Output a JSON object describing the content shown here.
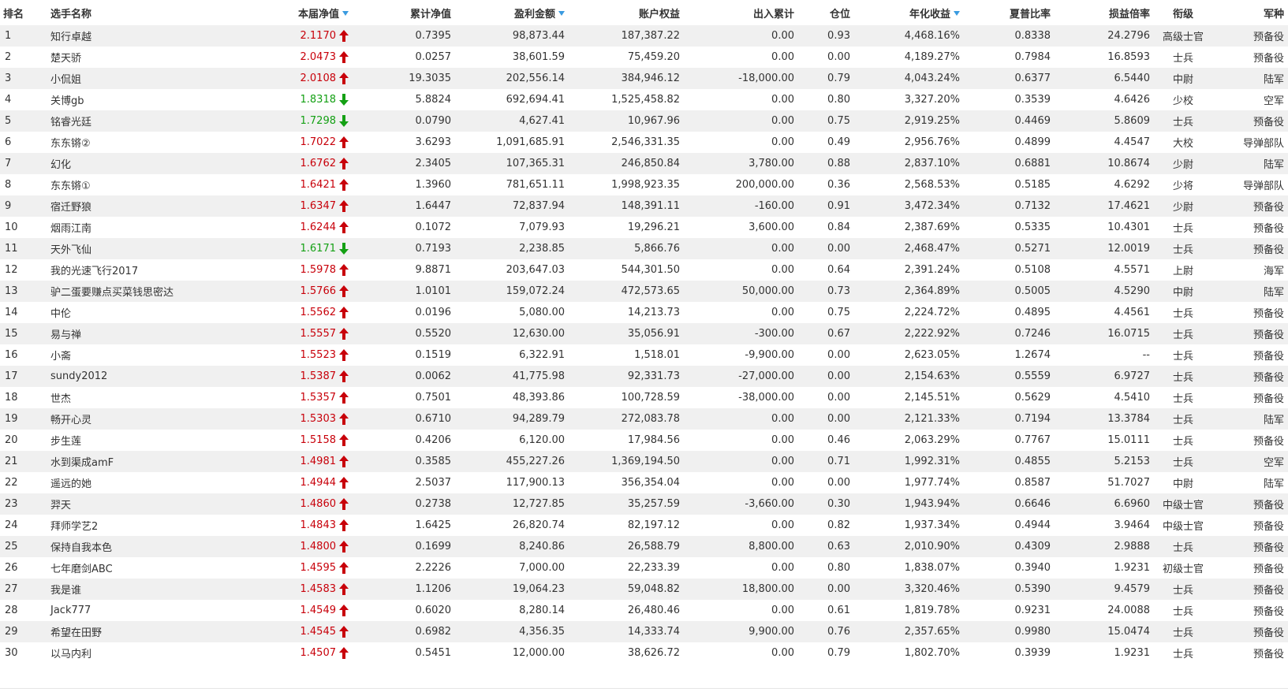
{
  "headers": {
    "rank": "排名",
    "name": "选手名称",
    "nav": "本届净值",
    "cum_nav": "累计净值",
    "profit": "盈利金额",
    "equity": "账户权益",
    "flow": "出入累计",
    "position": "仓位",
    "annual": "年化收益",
    "sharpe": "夏普比率",
    "ratio": "损益倍率",
    "rank_title": "衔级",
    "branch": "军种"
  },
  "colors": {
    "up": "#c8000a",
    "down": "#14a014",
    "sort": "#3a9be0",
    "alt_row": "#f0f0f0"
  },
  "rows": [
    {
      "rank": "1",
      "name": "知行卓越",
      "nav": "2.1170",
      "dir": "up",
      "cum": "0.7395",
      "profit": "98,873.44",
      "equity": "187,387.22",
      "flow": "0.00",
      "pos": "0.93",
      "annual": "4,468.16%",
      "sharpe": "0.8338",
      "ratio": "24.2796",
      "rank_title": "高级士官",
      "branch": "预备役"
    },
    {
      "rank": "2",
      "name": "楚天骄",
      "nav": "2.0473",
      "dir": "up",
      "cum": "0.0257",
      "profit": "38,601.59",
      "equity": "75,459.20",
      "flow": "0.00",
      "pos": "0.00",
      "annual": "4,189.27%",
      "sharpe": "0.7984",
      "ratio": "16.8593",
      "rank_title": "士兵",
      "branch": "预备役"
    },
    {
      "rank": "3",
      "name": "小侃姐",
      "nav": "2.0108",
      "dir": "up",
      "cum": "19.3035",
      "profit": "202,556.14",
      "equity": "384,946.12",
      "flow": "-18,000.00",
      "pos": "0.79",
      "annual": "4,043.24%",
      "sharpe": "0.6377",
      "ratio": "6.5440",
      "rank_title": "中尉",
      "branch": "陆军"
    },
    {
      "rank": "4",
      "name": "关博gb",
      "nav": "1.8318",
      "dir": "down",
      "cum": "5.8824",
      "profit": "692,694.41",
      "equity": "1,525,458.82",
      "flow": "0.00",
      "pos": "0.80",
      "annual": "3,327.20%",
      "sharpe": "0.3539",
      "ratio": "4.6426",
      "rank_title": "少校",
      "branch": "空军"
    },
    {
      "rank": "5",
      "name": "铭睿光廷",
      "nav": "1.7298",
      "dir": "down",
      "cum": "0.0790",
      "profit": "4,627.41",
      "equity": "10,967.96",
      "flow": "0.00",
      "pos": "0.75",
      "annual": "2,919.25%",
      "sharpe": "0.4469",
      "ratio": "5.8609",
      "rank_title": "士兵",
      "branch": "预备役"
    },
    {
      "rank": "6",
      "name": "东东锵②",
      "nav": "1.7022",
      "dir": "up",
      "cum": "3.6293",
      "profit": "1,091,685.91",
      "equity": "2,546,331.35",
      "flow": "0.00",
      "pos": "0.49",
      "annual": "2,956.76%",
      "sharpe": "0.4899",
      "ratio": "4.4547",
      "rank_title": "大校",
      "branch": "导弹部队"
    },
    {
      "rank": "7",
      "name": "幻化",
      "nav": "1.6762",
      "dir": "up",
      "cum": "2.3405",
      "profit": "107,365.31",
      "equity": "246,850.84",
      "flow": "3,780.00",
      "pos": "0.88",
      "annual": "2,837.10%",
      "sharpe": "0.6881",
      "ratio": "10.8674",
      "rank_title": "少尉",
      "branch": "陆军"
    },
    {
      "rank": "8",
      "name": "东东锵①",
      "nav": "1.6421",
      "dir": "up",
      "cum": "1.3960",
      "profit": "781,651.11",
      "equity": "1,998,923.35",
      "flow": "200,000.00",
      "pos": "0.36",
      "annual": "2,568.53%",
      "sharpe": "0.5185",
      "ratio": "4.6292",
      "rank_title": "少将",
      "branch": "导弹部队"
    },
    {
      "rank": "9",
      "name": "宿迁野狼",
      "nav": "1.6347",
      "dir": "up",
      "cum": "1.6447",
      "profit": "72,837.94",
      "equity": "148,391.11",
      "flow": "-160.00",
      "pos": "0.91",
      "annual": "3,472.34%",
      "sharpe": "0.7132",
      "ratio": "17.4621",
      "rank_title": "少尉",
      "branch": "预备役"
    },
    {
      "rank": "10",
      "name": "烟雨江南",
      "nav": "1.6244",
      "dir": "up",
      "cum": "0.1072",
      "profit": "7,079.93",
      "equity": "19,296.21",
      "flow": "3,600.00",
      "pos": "0.84",
      "annual": "2,387.69%",
      "sharpe": "0.5335",
      "ratio": "10.4301",
      "rank_title": "士兵",
      "branch": "预备役"
    },
    {
      "rank": "11",
      "name": "天外飞仙",
      "nav": "1.6171",
      "dir": "down",
      "cum": "0.7193",
      "profit": "2,238.85",
      "equity": "5,866.76",
      "flow": "0.00",
      "pos": "0.00",
      "annual": "2,468.47%",
      "sharpe": "0.5271",
      "ratio": "12.0019",
      "rank_title": "士兵",
      "branch": "预备役"
    },
    {
      "rank": "12",
      "name": "我的光速飞行2017",
      "nav": "1.5978",
      "dir": "up",
      "cum": "9.8871",
      "profit": "203,647.03",
      "equity": "544,301.50",
      "flow": "0.00",
      "pos": "0.64",
      "annual": "2,391.24%",
      "sharpe": "0.5108",
      "ratio": "4.5571",
      "rank_title": "上尉",
      "branch": "海军"
    },
    {
      "rank": "13",
      "name": "驴二蛋要赚点买菜钱思密达",
      "nav": "1.5766",
      "dir": "up",
      "cum": "1.0101",
      "profit": "159,072.24",
      "equity": "472,573.65",
      "flow": "50,000.00",
      "pos": "0.73",
      "annual": "2,364.89%",
      "sharpe": "0.5005",
      "ratio": "4.5290",
      "rank_title": "中尉",
      "branch": "陆军"
    },
    {
      "rank": "14",
      "name": "中伦",
      "nav": "1.5562",
      "dir": "up",
      "cum": "0.0196",
      "profit": "5,080.00",
      "equity": "14,213.73",
      "flow": "0.00",
      "pos": "0.75",
      "annual": "2,224.72%",
      "sharpe": "0.4895",
      "ratio": "4.4561",
      "rank_title": "士兵",
      "branch": "预备役"
    },
    {
      "rank": "15",
      "name": "易与禅",
      "nav": "1.5557",
      "dir": "up",
      "cum": "0.5520",
      "profit": "12,630.00",
      "equity": "35,056.91",
      "flow": "-300.00",
      "pos": "0.67",
      "annual": "2,222.92%",
      "sharpe": "0.7246",
      "ratio": "16.0715",
      "rank_title": "士兵",
      "branch": "预备役"
    },
    {
      "rank": "16",
      "name": "小斋",
      "nav": "1.5523",
      "dir": "up",
      "cum": "0.1519",
      "profit": "6,322.91",
      "equity": "1,518.01",
      "flow": "-9,900.00",
      "pos": "0.00",
      "annual": "2,623.05%",
      "sharpe": "1.2674",
      "ratio": "--",
      "rank_title": "士兵",
      "branch": "预备役"
    },
    {
      "rank": "17",
      "name": "sundy2012",
      "nav": "1.5387",
      "dir": "up",
      "cum": "0.0062",
      "profit": "41,775.98",
      "equity": "92,331.73",
      "flow": "-27,000.00",
      "pos": "0.00",
      "annual": "2,154.63%",
      "sharpe": "0.5559",
      "ratio": "6.9727",
      "rank_title": "士兵",
      "branch": "预备役"
    },
    {
      "rank": "18",
      "name": "世杰",
      "nav": "1.5357",
      "dir": "up",
      "cum": "0.7501",
      "profit": "48,393.86",
      "equity": "100,728.59",
      "flow": "-38,000.00",
      "pos": "0.00",
      "annual": "2,145.51%",
      "sharpe": "0.5629",
      "ratio": "4.5410",
      "rank_title": "士兵",
      "branch": "预备役"
    },
    {
      "rank": "19",
      "name": "畅开心灵",
      "nav": "1.5303",
      "dir": "up",
      "cum": "0.6710",
      "profit": "94,289.79",
      "equity": "272,083.78",
      "flow": "0.00",
      "pos": "0.00",
      "annual": "2,121.33%",
      "sharpe": "0.7194",
      "ratio": "13.3784",
      "rank_title": "士兵",
      "branch": "陆军"
    },
    {
      "rank": "20",
      "name": "步生莲",
      "nav": "1.5158",
      "dir": "up",
      "cum": "0.4206",
      "profit": "6,120.00",
      "equity": "17,984.56",
      "flow": "0.00",
      "pos": "0.46",
      "annual": "2,063.29%",
      "sharpe": "0.7767",
      "ratio": "15.0111",
      "rank_title": "士兵",
      "branch": "预备役"
    },
    {
      "rank": "21",
      "name": "水到渠成amF",
      "nav": "1.4981",
      "dir": "up",
      "cum": "0.3585",
      "profit": "455,227.26",
      "equity": "1,369,194.50",
      "flow": "0.00",
      "pos": "0.71",
      "annual": "1,992.31%",
      "sharpe": "0.4855",
      "ratio": "5.2153",
      "rank_title": "士兵",
      "branch": "空军"
    },
    {
      "rank": "22",
      "name": "遥远的她",
      "nav": "1.4944",
      "dir": "up",
      "cum": "2.5037",
      "profit": "117,900.13",
      "equity": "356,354.04",
      "flow": "0.00",
      "pos": "0.00",
      "annual": "1,977.74%",
      "sharpe": "0.8587",
      "ratio": "51.7027",
      "rank_title": "中尉",
      "branch": "陆军"
    },
    {
      "rank": "23",
      "name": "羿天",
      "nav": "1.4860",
      "dir": "up",
      "cum": "0.2738",
      "profit": "12,727.85",
      "equity": "35,257.59",
      "flow": "-3,660.00",
      "pos": "0.30",
      "annual": "1,943.94%",
      "sharpe": "0.6646",
      "ratio": "6.6960",
      "rank_title": "中级士官",
      "branch": "预备役"
    },
    {
      "rank": "24",
      "name": "拜师学艺2",
      "nav": "1.4843",
      "dir": "up",
      "cum": "1.6425",
      "profit": "26,820.74",
      "equity": "82,197.12",
      "flow": "0.00",
      "pos": "0.82",
      "annual": "1,937.34%",
      "sharpe": "0.4944",
      "ratio": "3.9464",
      "rank_title": "中级士官",
      "branch": "预备役"
    },
    {
      "rank": "25",
      "name": "保持自我本色",
      "nav": "1.4800",
      "dir": "up",
      "cum": "0.1699",
      "profit": "8,240.86",
      "equity": "26,588.79",
      "flow": "8,800.00",
      "pos": "0.63",
      "annual": "2,010.90%",
      "sharpe": "0.4309",
      "ratio": "2.9888",
      "rank_title": "士兵",
      "branch": "预备役"
    },
    {
      "rank": "26",
      "name": "七年磨剑ABC",
      "nav": "1.4595",
      "dir": "up",
      "cum": "2.2226",
      "profit": "7,000.00",
      "equity": "22,233.39",
      "flow": "0.00",
      "pos": "0.80",
      "annual": "1,838.07%",
      "sharpe": "0.3940",
      "ratio": "1.9231",
      "rank_title": "初级士官",
      "branch": "预备役"
    },
    {
      "rank": "27",
      "name": "我是谁",
      "nav": "1.4583",
      "dir": "up",
      "cum": "1.1206",
      "profit": "19,064.23",
      "equity": "59,048.82",
      "flow": "18,800.00",
      "pos": "0.00",
      "annual": "3,320.46%",
      "sharpe": "0.5390",
      "ratio": "9.4579",
      "rank_title": "士兵",
      "branch": "预备役"
    },
    {
      "rank": "28",
      "name": "Jack777",
      "nav": "1.4549",
      "dir": "up",
      "cum": "0.6020",
      "profit": "8,280.14",
      "equity": "26,480.46",
      "flow": "0.00",
      "pos": "0.61",
      "annual": "1,819.78%",
      "sharpe": "0.9231",
      "ratio": "24.0088",
      "rank_title": "士兵",
      "branch": "预备役"
    },
    {
      "rank": "29",
      "name": "希望在田野",
      "nav": "1.4545",
      "dir": "up",
      "cum": "0.6982",
      "profit": "4,356.35",
      "equity": "14,333.74",
      "flow": "9,900.00",
      "pos": "0.76",
      "annual": "2,357.65%",
      "sharpe": "0.9980",
      "ratio": "15.0474",
      "rank_title": "士兵",
      "branch": "预备役"
    },
    {
      "rank": "30",
      "name": "以马内利",
      "nav": "1.4507",
      "dir": "up",
      "cum": "0.5451",
      "profit": "12,000.00",
      "equity": "38,626.72",
      "flow": "0.00",
      "pos": "0.79",
      "annual": "1,802.70%",
      "sharpe": "0.3939",
      "ratio": "1.9231",
      "rank_title": "士兵",
      "branch": "预备役"
    }
  ]
}
